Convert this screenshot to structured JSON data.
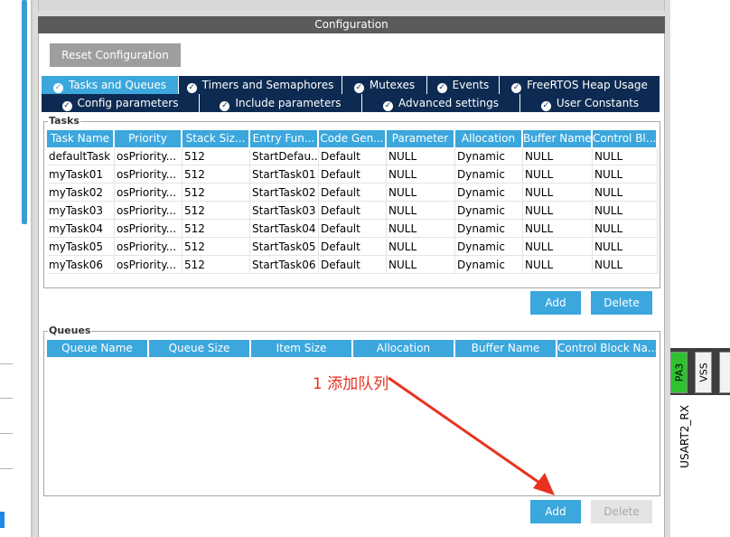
{
  "panel": {
    "header": "Configuration",
    "reset_label": "Reset Configuration"
  },
  "tabs_row1": [
    {
      "label": "Tasks and Queues",
      "active": true
    },
    {
      "label": "Timers and Semaphores",
      "active": false
    },
    {
      "label": "Mutexes",
      "active": false
    },
    {
      "label": "Events",
      "active": false
    },
    {
      "label": "FreeRTOS Heap Usage",
      "active": false
    }
  ],
  "tabs_row2": [
    {
      "label": "Config parameters"
    },
    {
      "label": "Include parameters"
    },
    {
      "label": "Advanced settings"
    },
    {
      "label": "User Constants"
    }
  ],
  "tasks": {
    "group_title": "Tasks",
    "headers": [
      "Task Name",
      "Priority",
      "Stack Siz...",
      "Entry Fun...",
      "Code Gen...",
      "Parameter",
      "Allocation",
      "Buffer Name",
      "Control Bl..."
    ],
    "rows": [
      [
        "defaultTask",
        "osPriority...",
        "512",
        "StartDefau...",
        "Default",
        "NULL",
        "Dynamic",
        "NULL",
        "NULL"
      ],
      [
        "myTask01",
        "osPriority...",
        "512",
        "StartTask01",
        "Default",
        "NULL",
        "Dynamic",
        "NULL",
        "NULL"
      ],
      [
        "myTask02",
        "osPriority...",
        "512",
        "StartTask02",
        "Default",
        "NULL",
        "Dynamic",
        "NULL",
        "NULL"
      ],
      [
        "myTask03",
        "osPriority...",
        "512",
        "StartTask03",
        "Default",
        "NULL",
        "Dynamic",
        "NULL",
        "NULL"
      ],
      [
        "myTask04",
        "osPriority...",
        "512",
        "StartTask04",
        "Default",
        "NULL",
        "Dynamic",
        "NULL",
        "NULL"
      ],
      [
        "myTask05",
        "osPriority...",
        "512",
        "StartTask05",
        "Default",
        "NULL",
        "Dynamic",
        "NULL",
        "NULL"
      ],
      [
        "myTask06",
        "osPriority...",
        "512",
        "StartTask06",
        "Default",
        "NULL",
        "Dynamic",
        "NULL",
        "NULL"
      ]
    ],
    "add_label": "Add",
    "delete_label": "Delete"
  },
  "queues": {
    "group_title": "Queues",
    "headers": [
      "Queue Name",
      "Queue Size",
      "Item Size",
      "Allocation",
      "Buffer Name",
      "Control Block Na..."
    ],
    "rows": [],
    "add_label": "Add",
    "delete_label": "Delete"
  },
  "annotation": {
    "text": "1 添加队列",
    "color": "#e8321f"
  },
  "pins": [
    {
      "label": "PA3",
      "color": "#2fc12f"
    },
    {
      "label": "VSS",
      "color": "#f2f2f2"
    },
    {
      "label": "",
      "color": "#f2f2f2"
    }
  ],
  "pin_signal": "USART2_RX",
  "icons": {
    "tab_check": "check-circle-icon"
  },
  "colors": {
    "accent": "#3ba7dd",
    "tab_dark": "#0d2b52",
    "header_gray": "#5b5b5b"
  }
}
